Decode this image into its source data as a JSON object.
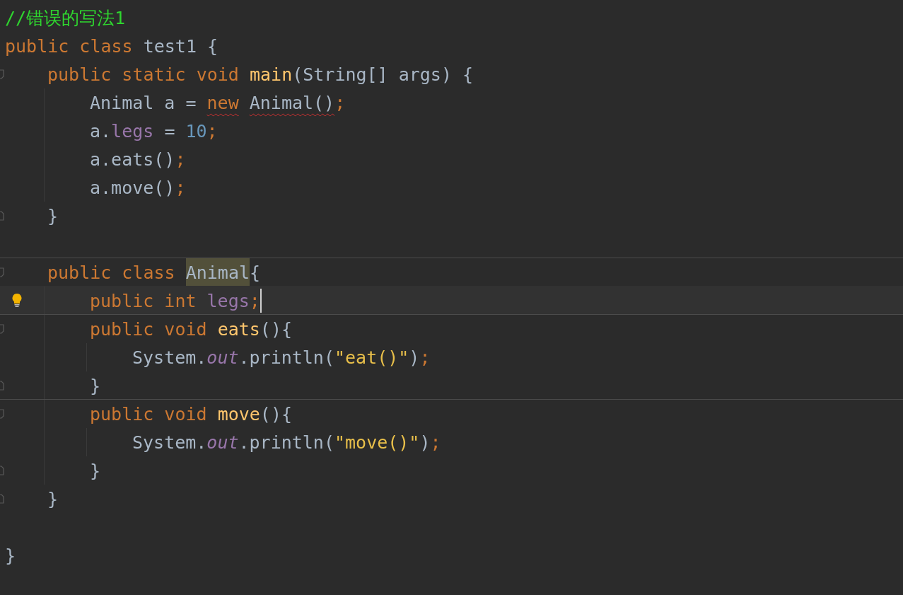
{
  "editor": {
    "lines": [
      {
        "kind": "code",
        "tokens": [
          {
            "text": "//错误的写法1",
            "kind": "comment"
          }
        ]
      },
      {
        "kind": "code",
        "tokens": [
          {
            "text": "public",
            "kind": "keyword"
          },
          {
            "text": "class",
            "kind": "keyword",
            "gap": true
          },
          {
            "text": "test1 {",
            "kind": "plain",
            "gap": true
          }
        ],
        "children": [
          {
            "kind": "code",
            "fold_open": true,
            "tokens": [
              {
                "text": "public",
                "kind": "keyword"
              },
              {
                "text": "static",
                "kind": "keyword",
                "gap": true
              },
              {
                "text": "void",
                "kind": "keyword",
                "gap": true
              },
              {
                "text": "main",
                "kind": "method",
                "gap": true
              },
              {
                "text": "(String[] args) {",
                "kind": "plain"
              }
            ],
            "children": [
              {
                "kind": "code",
                "tokens": [
                  {
                    "text": "Animal a =",
                    "kind": "plain"
                  },
                  {
                    "text": "new",
                    "kind": "keyword",
                    "gap": true,
                    "error": true
                  },
                  {
                    "text": "Animal()",
                    "kind": "plain",
                    "gap": true,
                    "error": true
                  },
                  {
                    "text": ";",
                    "kind": "punct"
                  }
                ]
              },
              {
                "kind": "code",
                "tokens": [
                  {
                    "text": "a.",
                    "kind": "plain"
                  },
                  {
                    "text": "legs",
                    "kind": "field"
                  },
                  {
                    "text": "=",
                    "kind": "plain",
                    "gap": true
                  },
                  {
                    "text": "10",
                    "kind": "number",
                    "gap": true
                  },
                  {
                    "text": ";",
                    "kind": "punct"
                  }
                ]
              },
              {
                "kind": "code",
                "tokens": [
                  {
                    "text": "a.eats()",
                    "kind": "plain"
                  },
                  {
                    "text": ";",
                    "kind": "punct"
                  }
                ]
              },
              {
                "kind": "code",
                "tokens": [
                  {
                    "text": "a.move()",
                    "kind": "plain"
                  },
                  {
                    "text": ";",
                    "kind": "punct"
                  }
                ]
              }
            ]
          },
          {
            "kind": "code",
            "fold_close": true,
            "tokens": [
              {
                "text": "}",
                "kind": "plain"
              }
            ]
          },
          {
            "kind": "blank"
          },
          {
            "kind": "code",
            "fold_open": true,
            "separator": true,
            "tokens": [
              {
                "text": "public",
                "kind": "keyword"
              },
              {
                "text": "class",
                "kind": "keyword",
                "gap": true
              },
              {
                "text": "Animal",
                "kind": "plain",
                "gap": true,
                "highlight": true
              },
              {
                "text": "{",
                "kind": "plain"
              }
            ],
            "children": [
              {
                "kind": "code",
                "current": true,
                "bulb": true,
                "caret": true,
                "tokens": [
                  {
                    "text": "public",
                    "kind": "keyword"
                  },
                  {
                    "text": "int",
                    "kind": "keyword",
                    "gap": true
                  },
                  {
                    "text": "legs",
                    "kind": "field",
                    "gap": true
                  },
                  {
                    "text": ";",
                    "kind": "punct"
                  }
                ]
              },
              {
                "kind": "code",
                "fold_open": true,
                "separator": true,
                "tokens": [
                  {
                    "text": "public",
                    "kind": "keyword"
                  },
                  {
                    "text": "void",
                    "kind": "keyword",
                    "gap": true
                  },
                  {
                    "text": "eats",
                    "kind": "method",
                    "gap": true
                  },
                  {
                    "text": "(){",
                    "kind": "plain"
                  }
                ],
                "children": [
                  {
                    "kind": "code",
                    "tokens": [
                      {
                        "text": "System.",
                        "kind": "plain"
                      },
                      {
                        "text": "out",
                        "kind": "static"
                      },
                      {
                        "text": ".println(",
                        "kind": "plain"
                      },
                      {
                        "text": "\"eat()\"",
                        "kind": "string"
                      },
                      {
                        "text": ")",
                        "kind": "plain"
                      },
                      {
                        "text": ";",
                        "kind": "punct"
                      }
                    ]
                  }
                ]
              },
              {
                "kind": "code",
                "fold_close": true,
                "tokens": [
                  {
                    "text": "}",
                    "kind": "plain"
                  }
                ]
              },
              {
                "kind": "code",
                "fold_open": true,
                "separator": true,
                "tokens": [
                  {
                    "text": "public",
                    "kind": "keyword"
                  },
                  {
                    "text": "void",
                    "kind": "keyword",
                    "gap": true
                  },
                  {
                    "text": "move",
                    "kind": "method",
                    "gap": true
                  },
                  {
                    "text": "(){",
                    "kind": "plain"
                  }
                ],
                "children": [
                  {
                    "kind": "code",
                    "tokens": [
                      {
                        "text": "System.",
                        "kind": "plain"
                      },
                      {
                        "text": "out",
                        "kind": "static"
                      },
                      {
                        "text": ".println(",
                        "kind": "plain"
                      },
                      {
                        "text": "\"move()\"",
                        "kind": "string"
                      },
                      {
                        "text": ")",
                        "kind": "plain"
                      },
                      {
                        "text": ";",
                        "kind": "punct"
                      }
                    ]
                  }
                ]
              },
              {
                "kind": "code",
                "fold_close": true,
                "tokens": [
                  {
                    "text": "}",
                    "kind": "plain"
                  }
                ]
              }
            ]
          },
          {
            "kind": "code",
            "fold_close": true,
            "tokens": [
              {
                "text": "}",
                "kind": "plain"
              }
            ]
          },
          {
            "kind": "blank"
          }
        ]
      },
      {
        "kind": "code",
        "tokens": [
          {
            "text": "}",
            "kind": "plain"
          }
        ]
      }
    ]
  }
}
